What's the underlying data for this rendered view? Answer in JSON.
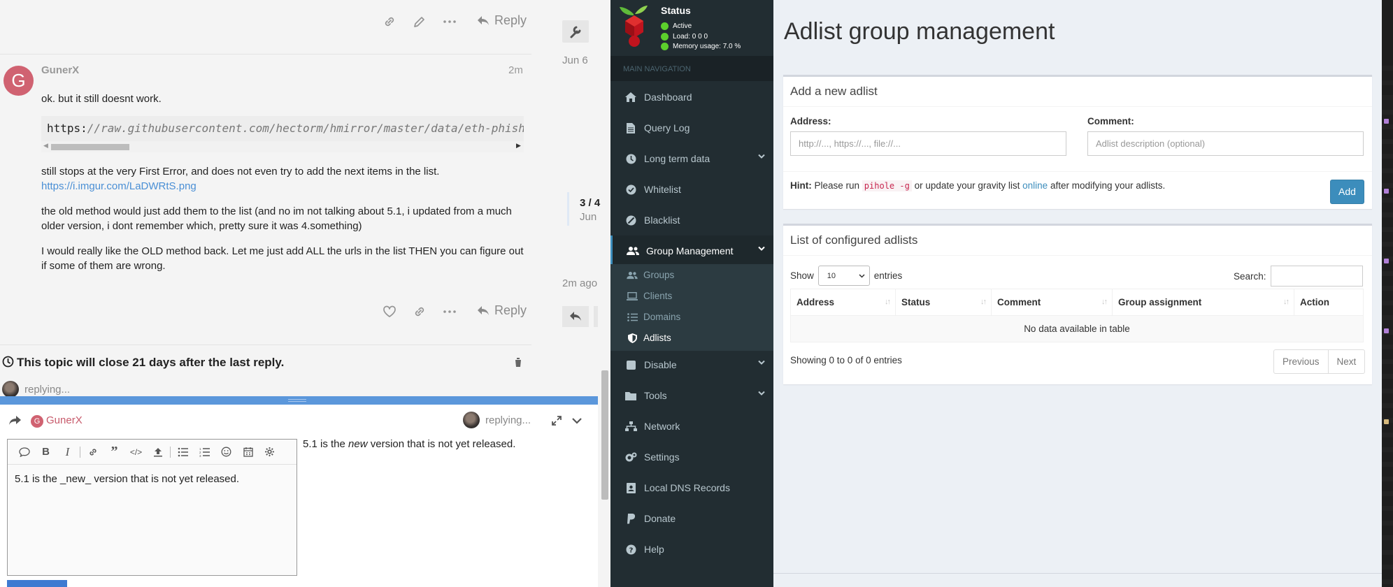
{
  "forum": {
    "actions": {
      "reply": "Reply"
    },
    "timeline": {
      "date_top": "Jun 6",
      "position": "3 / 4",
      "date_mid": "Jun",
      "ago": "2m ago"
    },
    "post": {
      "avatar_letter": "G",
      "username": "GunerX",
      "age": "2m",
      "line1": "ok. but it still doesnt work.",
      "code_prefix": "https:",
      "code_rest": "//raw.githubusercontent.com/hectorm/hmirror/master/data/eth-phishing-d",
      "line2": "still stops at the very First Error, and does not even try to add the next items in the list.",
      "link": "https://i.imgur.com/LaDWRtS.png",
      "line3a": "the old method would just add them to the list (and no im not talking about 5.1, i updated from a much",
      "line3b": "older version, i dont remember which, pretty sure it was 4.something)",
      "line4a": "I would really like the OLD method back. Let me just add ALL the urls in the list THEN you can figure out",
      "line4b": "if some of them are wrong."
    },
    "topic_notice": "This topic will close 21 days after the last reply.",
    "replying_label": "replying...",
    "composer": {
      "reply_to_user": "GunerX",
      "replying_label": "replying...",
      "editor_text": "5.1 is the _new_ version that is not yet released.",
      "preview_before": "5.1 is the ",
      "preview_em": "new",
      "preview_after": " version that is not yet released."
    }
  },
  "pihole": {
    "status": {
      "title": "Status",
      "active": "Active",
      "load": "Load:  0  0  0",
      "memory": "Memory usage:  7.0 %"
    },
    "main_navigation": "MAIN NAVIGATION",
    "nav": {
      "dashboard": "Dashboard",
      "query_log": "Query Log",
      "long_term": "Long term data",
      "whitelist": "Whitelist",
      "blacklist": "Blacklist",
      "group_mgmt": "Group Management",
      "groups": "Groups",
      "clients": "Clients",
      "domains": "Domains",
      "adlists": "Adlists",
      "disable": "Disable",
      "tools": "Tools",
      "network": "Network",
      "settings": "Settings",
      "local_dns": "Local DNS Records",
      "donate": "Donate",
      "help": "Help"
    },
    "page_title": "Adlist group management",
    "add_box": {
      "title": "Add a new adlist",
      "address_label": "Address:",
      "address_placeholder": "http://..., https://..., file://...",
      "comment_label": "Comment:",
      "comment_placeholder": "Adlist description (optional)",
      "hint_label": "Hint:",
      "hint_1": " Please run ",
      "hint_code": "pihole -g",
      "hint_2": " or update your gravity list ",
      "hint_link": "online",
      "hint_3": " after modifying your adlists.",
      "add_button": "Add"
    },
    "list_box": {
      "title": "List of configured adlists",
      "show_label": "Show",
      "show_value": "10",
      "entries_label": "entries",
      "search_label": "Search:",
      "columns": [
        "Address",
        "Status",
        "Comment",
        "Group assignment",
        "Action"
      ],
      "empty": "No data available in table",
      "showing": "Showing 0 to 0 of 0 entries",
      "previous": "Previous",
      "next": "Next"
    }
  },
  "colors": {
    "pihole_sidebar": "#222d32",
    "pihole_accent": "#3c8dbc",
    "forum_blue": "#5b97db",
    "status_green": "#5cd02c",
    "avatar_pink": "#d06271"
  }
}
